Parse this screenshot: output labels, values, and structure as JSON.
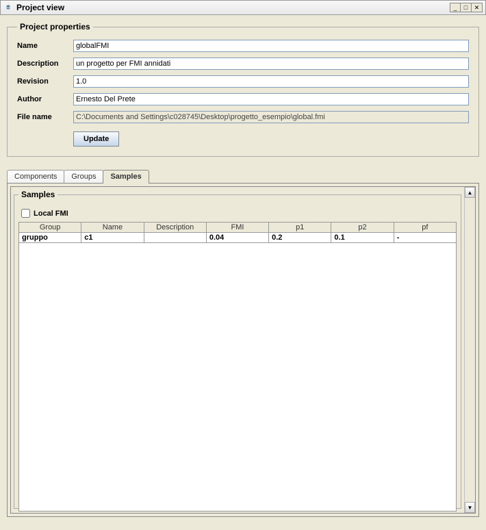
{
  "window": {
    "title": "Project view"
  },
  "project_properties": {
    "legend": "Project properties",
    "labels": {
      "name": "Name",
      "description": "Description",
      "revision": "Revision",
      "author": "Author",
      "filename": "File name"
    },
    "values": {
      "name": "globalFMI",
      "description": "un progetto per FMI annidati",
      "revision": "1.0",
      "author": "Ernesto Del Prete",
      "filename": "C:\\Documents and Settings\\c028745\\Desktop\\progetto_esempio\\global.fmi"
    },
    "update_label": "Update"
  },
  "tabs": {
    "components": "Components",
    "groups": "Groups",
    "samples": "Samples"
  },
  "samples_panel": {
    "legend": "Samples",
    "local_fmi_label": "Local FMI",
    "columns": {
      "group": "Group",
      "name": "Name",
      "description": "Description",
      "fmi": "FMI",
      "p1": "p1",
      "p2": "p2",
      "pf": "pf"
    },
    "rows": [
      {
        "group": "gruppo",
        "name": "c1",
        "description": "",
        "fmi": "0.04",
        "p1": "0.2",
        "p2": "0.1",
        "pf": "-"
      }
    ]
  }
}
